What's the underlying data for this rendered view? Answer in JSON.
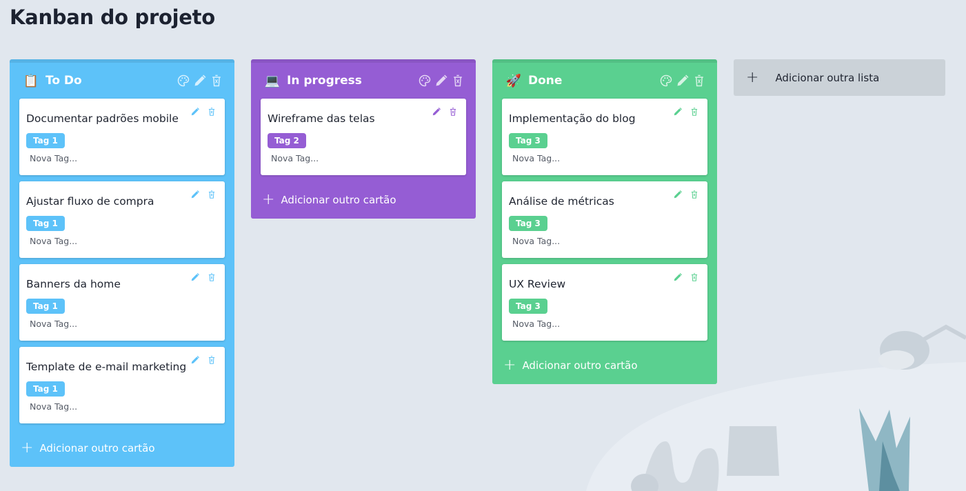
{
  "page": {
    "title": "Kanban do projeto"
  },
  "lists": [
    {
      "title": "To Do",
      "emoji": "📋",
      "color": "#5dc2f9",
      "icon_color": "#5dc2f9",
      "add_card_label": "Adicionar outro cartão",
      "cards": [
        {
          "title": "Documentar padrões mobile",
          "tag": "Tag 1",
          "new_tag": "Nova Tag..."
        },
        {
          "title": "Ajustar fluxo de compra",
          "tag": "Tag 1",
          "new_tag": "Nova Tag..."
        },
        {
          "title": "Banners da home",
          "tag": "Tag 1",
          "new_tag": "Nova Tag..."
        },
        {
          "title": "Template de e-mail marketing",
          "tag": "Tag 1",
          "new_tag": "Nova Tag..."
        }
      ]
    },
    {
      "title": "In progress",
      "emoji": "💻",
      "color": "#955dd4",
      "icon_color": "#955dd4",
      "add_card_label": "Adicionar outro cartão",
      "cards": [
        {
          "title": "Wireframe das telas",
          "tag": "Tag 2",
          "new_tag": "Nova Tag..."
        }
      ]
    },
    {
      "title": "Done",
      "emoji": "🚀",
      "color": "#5ad090",
      "icon_color": "#5ad090",
      "add_card_label": "Adicionar outro cartão",
      "cards": [
        {
          "title": "Implementação do blog",
          "tag": "Tag 3",
          "new_tag": "Nova Tag..."
        },
        {
          "title": "Análise de métricas",
          "tag": "Tag 3",
          "new_tag": "Nova Tag..."
        },
        {
          "title": "UX Review",
          "tag": "Tag 3",
          "new_tag": "Nova Tag..."
        }
      ]
    }
  ],
  "add_list": {
    "label": "Adicionar outra lista",
    "icon": "plus-icon"
  },
  "icons": {
    "list": [
      "palette-icon",
      "pencil-icon",
      "trash-icon"
    ],
    "card": [
      "pencil-icon",
      "trash-icon"
    ]
  }
}
